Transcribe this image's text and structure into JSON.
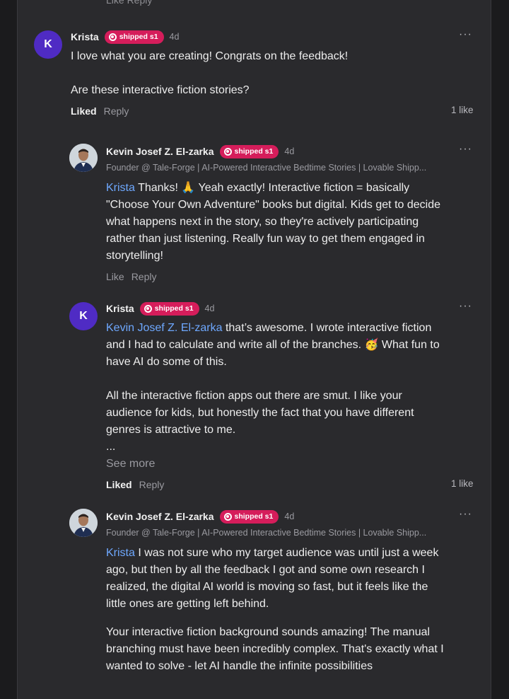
{
  "top_cut": "Like  Reply",
  "comments": [
    {
      "avatar_letter": "K",
      "name": "Krista",
      "badge": "shipped s1",
      "time": "4d",
      "lines": [
        "I love what you are creating! Congrats on the feedback!",
        "",
        "Are these interactive fiction stories?"
      ],
      "action_like": "Liked",
      "action_reply": "Reply",
      "likes": "1 like"
    },
    {
      "avatar_letter": "",
      "name": "Kevin Josef Z. El-zarka",
      "badge": "shipped s1",
      "time": "4d",
      "subtitle": "Founder @ Tale-Forge | AI-Powered Interactive Bedtime Stories | Lovable Shipp...",
      "mention": "Krista",
      "text": " Thanks! 🙏  Yeah exactly! Interactive fiction = basically \"Choose Your Own Adventure\" books but digital. Kids get to decide what happens next in the story, so they're actively participating rather than just listening.  Really fun way to get them engaged in storytelling!",
      "action_like": "Like",
      "action_reply": "Reply"
    },
    {
      "avatar_letter": "K",
      "name": "Krista",
      "badge": "shipped s1",
      "time": "4d",
      "mention": "Kevin Josef Z. El-zarka",
      "text": " that’s awesome. I wrote interactive fiction and I had to calculate and write all of the branches. 🥳 What fun to have AI do some of this.",
      "text2": "All the interactive fiction apps out there are smut. I like your audience for kids, but honestly the fact that you have different genres is attractive to me.",
      "ellipsis": "...",
      "see_more": "See more",
      "action_like": "Liked",
      "action_reply": "Reply",
      "likes": "1 like"
    },
    {
      "avatar_letter": "",
      "name": "Kevin Josef Z. El-zarka",
      "badge": "shipped s1",
      "time": "4d",
      "subtitle": "Founder @ Tale-Forge | AI-Powered Interactive Bedtime Stories | Lovable Shipp...",
      "mention": "Krista",
      "text": " I was not sure who my target audience was until just a week ago, but then by all the feedback I got and some own research I realized, the digital AI world is moving so fast, but it feels like the little ones are getting left behind.",
      "text2": "Your interactive fiction background sounds amazing! The manual branching must have been incredibly complex. That's exactly what I wanted to solve - let AI handle the infinite possibilities"
    }
  ],
  "icons": {
    "more": "more-icon",
    "badge": "ship-icon"
  },
  "colors": {
    "badge": "#d51d5b",
    "mention": "#6ea8fe",
    "avatar_k": "#4f2bc4"
  }
}
